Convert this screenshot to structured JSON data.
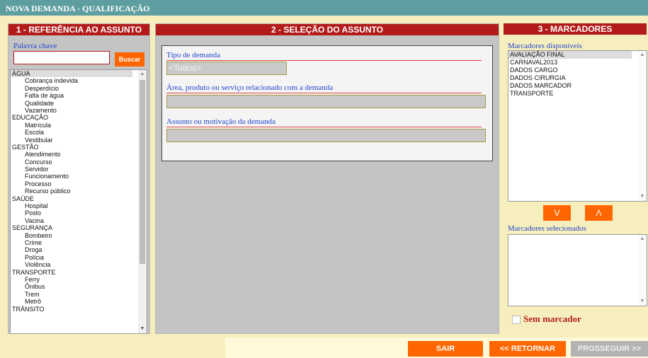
{
  "window": {
    "title": "NOVA DEMANDA - QUALIFICAÇÃO"
  },
  "panel1": {
    "title": "1 - REFERÊNCIA AO ASSUNTO",
    "keyword_label": "Palavra chave",
    "keyword_value": "",
    "search_button": "Buscar",
    "tree": [
      {
        "label": "ÁGUA",
        "level": 0,
        "selected": true
      },
      {
        "label": "Cobrança indevida",
        "level": 1
      },
      {
        "label": "Desperdício",
        "level": 1
      },
      {
        "label": "Falta de água",
        "level": 1
      },
      {
        "label": "Qualidade",
        "level": 1
      },
      {
        "label": "Vazamento",
        "level": 1
      },
      {
        "label": "EDUCAÇÃO",
        "level": 0
      },
      {
        "label": "Matrícula",
        "level": 1
      },
      {
        "label": "Escola",
        "level": 1
      },
      {
        "label": "Vestibular",
        "level": 1
      },
      {
        "label": "GESTÃO",
        "level": 0
      },
      {
        "label": "Atendimento",
        "level": 1
      },
      {
        "label": "Concurso",
        "level": 1
      },
      {
        "label": "Servidor",
        "level": 1
      },
      {
        "label": "Funcionamento",
        "level": 1
      },
      {
        "label": "Processo",
        "level": 1
      },
      {
        "label": "Recurso público",
        "level": 1
      },
      {
        "label": "SAÚDE",
        "level": 0
      },
      {
        "label": "Hospital",
        "level": 1
      },
      {
        "label": "Posto",
        "level": 1
      },
      {
        "label": "Vacina",
        "level": 1
      },
      {
        "label": "SEGURANÇA",
        "level": 0
      },
      {
        "label": "Bombeiro",
        "level": 1
      },
      {
        "label": "Crime",
        "level": 1
      },
      {
        "label": "Droga",
        "level": 1
      },
      {
        "label": "Polícia",
        "level": 1
      },
      {
        "label": "Violência",
        "level": 1
      },
      {
        "label": "TRANSPORTE",
        "level": 0
      },
      {
        "label": "Ferry",
        "level": 1
      },
      {
        "label": "Ônibus",
        "level": 1
      },
      {
        "label": "Trem",
        "level": 1
      },
      {
        "label": "Metrô",
        "level": 1
      },
      {
        "label": "TRÂNSITO",
        "level": 0
      }
    ]
  },
  "panel2": {
    "title": "2 - SELEÇÃO DO ASSUNTO",
    "tipo_label": "Tipo de demanda",
    "tipo_value": "<Todos>",
    "area_label": "Área, produto ou serviço relacionado com a demanda",
    "area_value": "",
    "assunto_label": "Assunto ou motivação da demanda",
    "assunto_value": ""
  },
  "panel3": {
    "title": "3 - MARCADORES",
    "available_label": "Marcadores disponíveis",
    "available": [
      "AVALIAÇÃO FINAL",
      "CARNAVAL2013",
      "DADOS CARGO",
      "DADOS CIRURGIA",
      "DADOS MARCADOR",
      "TRANSPORTE"
    ],
    "down_button": "V",
    "up_button": "Λ",
    "selected_label": "Marcadores selecionados",
    "no_marker_label": "Sem marcador",
    "no_marker_checked": false
  },
  "buttons": {
    "sair": "SAIR",
    "retornar": "<< RETORNAR",
    "prosseguir": "PROSSEGUIR >>"
  }
}
